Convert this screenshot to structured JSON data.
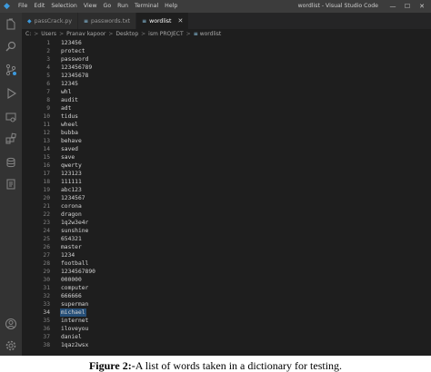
{
  "window": {
    "title": "wordlist - Visual Studio Code",
    "menu": [
      "File",
      "Edit",
      "Selection",
      "View",
      "Go",
      "Run",
      "Terminal",
      "Help"
    ],
    "controls": [
      "—",
      "☐",
      "✕"
    ]
  },
  "tabs": [
    {
      "label": "passCrack.py",
      "icon": "python-file-icon",
      "active": false
    },
    {
      "label": "passwords.txt",
      "icon": "text-file-icon",
      "active": false
    },
    {
      "label": "wordlist",
      "icon": "text-file-icon",
      "active": true,
      "close": "✕"
    }
  ],
  "breadcrumb": [
    "C:",
    "Users",
    "Pranav kapoor",
    "Desktop",
    "ism PROJECT",
    "wordlist"
  ],
  "breadcrumb_sep": ">",
  "breadcrumb_file_icon": "≡",
  "current_line": 34,
  "lines": [
    {
      "n": "1",
      "t": "123456"
    },
    {
      "n": "2",
      "t": "protect"
    },
    {
      "n": "3",
      "t": "password"
    },
    {
      "n": "4",
      "t": "123456789"
    },
    {
      "n": "5",
      "t": "12345678"
    },
    {
      "n": "6",
      "t": "12345"
    },
    {
      "n": "7",
      "t": "whl"
    },
    {
      "n": "8",
      "t": "audit"
    },
    {
      "n": "9",
      "t": "adt"
    },
    {
      "n": "10",
      "t": "tidus"
    },
    {
      "n": "11",
      "t": "wheel"
    },
    {
      "n": "12",
      "t": "bubba"
    },
    {
      "n": "13",
      "t": "behave"
    },
    {
      "n": "14",
      "t": "saved"
    },
    {
      "n": "15",
      "t": "save"
    },
    {
      "n": "16",
      "t": "qwerty"
    },
    {
      "n": "17",
      "t": "123123"
    },
    {
      "n": "18",
      "t": "111111"
    },
    {
      "n": "19",
      "t": "abc123"
    },
    {
      "n": "20",
      "t": "1234567"
    },
    {
      "n": "21",
      "t": "corona"
    },
    {
      "n": "22",
      "t": "dragon"
    },
    {
      "n": "23",
      "t": "1q2w3e4r"
    },
    {
      "n": "24",
      "t": "sunshine"
    },
    {
      "n": "25",
      "t": "654321"
    },
    {
      "n": "26",
      "t": "master"
    },
    {
      "n": "27",
      "t": "1234"
    },
    {
      "n": "28",
      "t": "football"
    },
    {
      "n": "29",
      "t": "1234567890"
    },
    {
      "n": "30",
      "t": "000000"
    },
    {
      "n": "31",
      "t": "computer"
    },
    {
      "n": "32",
      "t": "666666"
    },
    {
      "n": "33",
      "t": "superman"
    },
    {
      "n": "34",
      "t": "michael"
    },
    {
      "n": "35",
      "t": "internet"
    },
    {
      "n": "36",
      "t": "iloveyou"
    },
    {
      "n": "37",
      "t": "daniel"
    },
    {
      "n": "38",
      "t": "1qaz2wsx"
    }
  ],
  "caption": {
    "label": "Figure 2:-",
    "text": "A list of words taken in a dictionary for testing."
  },
  "colors": {
    "accent": "#3c99dc",
    "selection": "#264f78",
    "editor_bg": "#1e1e1e",
    "activity_bar": "#333333"
  },
  "activity_icons": [
    "explorer-icon",
    "search-icon",
    "source-control-icon",
    "run-debug-icon",
    "remote-explorer-icon",
    "extensions-icon",
    "database-icon",
    "notebook-icon",
    "account-icon",
    "settings-gear-icon"
  ]
}
